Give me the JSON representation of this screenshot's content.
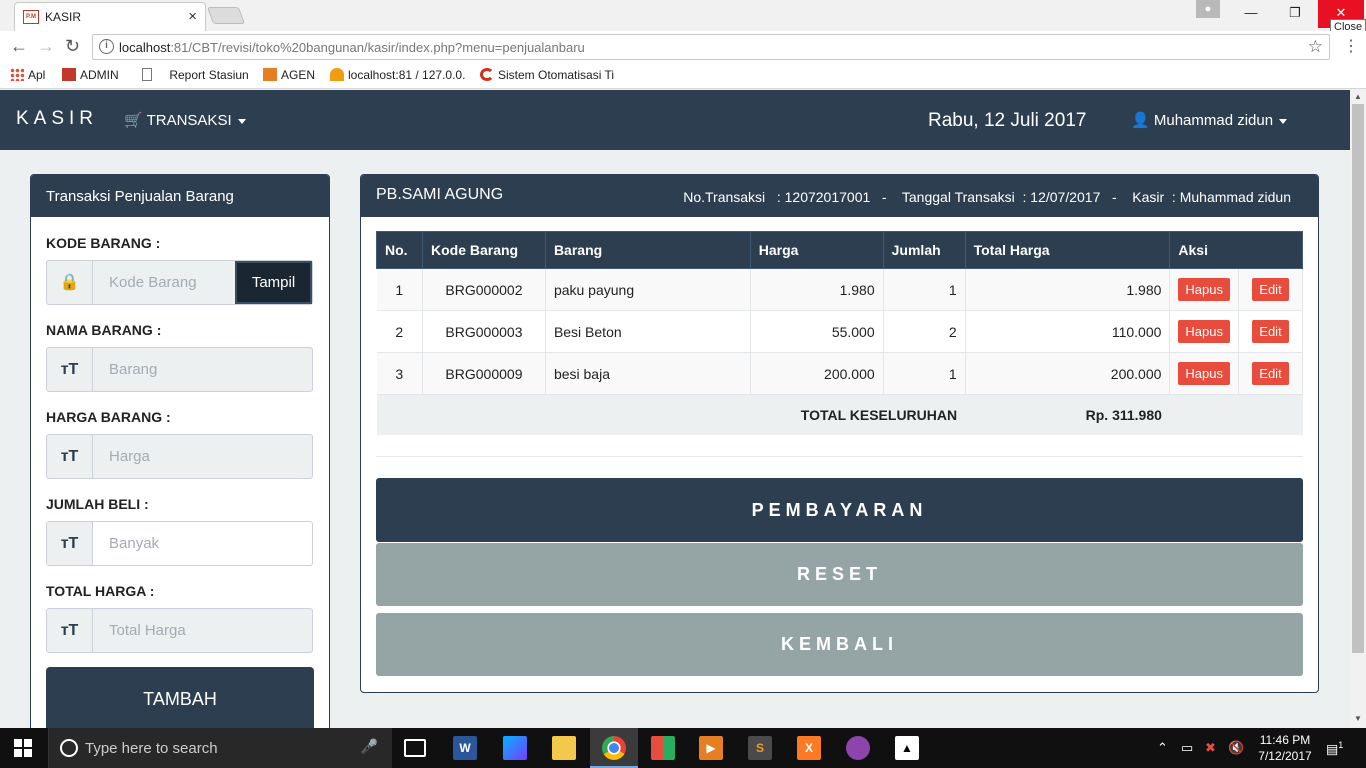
{
  "browser": {
    "tab_title": "KASIR",
    "tab_icon_text": "P.M",
    "close_tooltip": "Close",
    "url_host": "localhost",
    "url_rest": ":81/CBT/revisi/toko%20bangunan/kasir/index.php?menu=penjualanbaru",
    "bookmarks": [
      "Apl",
      "ADMIN",
      "Report Stasiun",
      "AGEN",
      "localhost:81 / 127.0.0.",
      "Sistem Otomatisasi Ti"
    ]
  },
  "navbar": {
    "brand": "KASIR",
    "menu_transaksi": "TRANSAKSI",
    "date": "Rabu, 12 Juli 2017",
    "user": "Muhammad zidun"
  },
  "left": {
    "title": "Transaksi Penjualan Barang",
    "kode_label": "KODE BARANG :",
    "kode_placeholder": "Kode  Barang",
    "tampil": "Tampil",
    "nama_label": "NAMA BARANG :",
    "nama_placeholder": "Barang",
    "harga_label": "HARGA BARANG :",
    "harga_placeholder": "Harga",
    "jumlah_label": "JUMLAH BELI :",
    "jumlah_placeholder": "Banyak",
    "total_label": "TOTAL HARGA :",
    "total_placeholder": "Total Harga",
    "tambah": "TAMBAH"
  },
  "right": {
    "shop": "PB.SAMI AGUNG",
    "meta": "No.Transaksi   : 12072017001   -    Tanggal Transaksi  : 12/07/2017   -    Kasir  : Muhammad zidun",
    "columns": [
      "No.",
      "Kode Barang",
      "Barang",
      "Harga",
      "Jumlah",
      "Total Harga",
      "Aksi"
    ],
    "rows": [
      {
        "no": "1",
        "kode": "BRG000002",
        "barang": "paku payung",
        "harga": "1.980",
        "jumlah": "1",
        "total": "1.980"
      },
      {
        "no": "2",
        "kode": "BRG000003",
        "barang": "Besi Beton",
        "harga": "55.000",
        "jumlah": "2",
        "total": "110.000"
      },
      {
        "no": "3",
        "kode": "BRG000009",
        "barang": "besi baja",
        "harga": "200.000",
        "jumlah": "1",
        "total": "200.000"
      }
    ],
    "hapus": "Hapus",
    "edit": "Edit",
    "total_label": "TOTAL KESELURUHAN",
    "total_value": "Rp. 311.980",
    "btn_pay": "PEMBAYARAN",
    "btn_reset": "RESET",
    "btn_back": "KEMBALI"
  },
  "taskbar": {
    "search_placeholder": "Type here to search",
    "time": "11:46 PM",
    "date": "7/12/2017",
    "notif_count": "1"
  }
}
